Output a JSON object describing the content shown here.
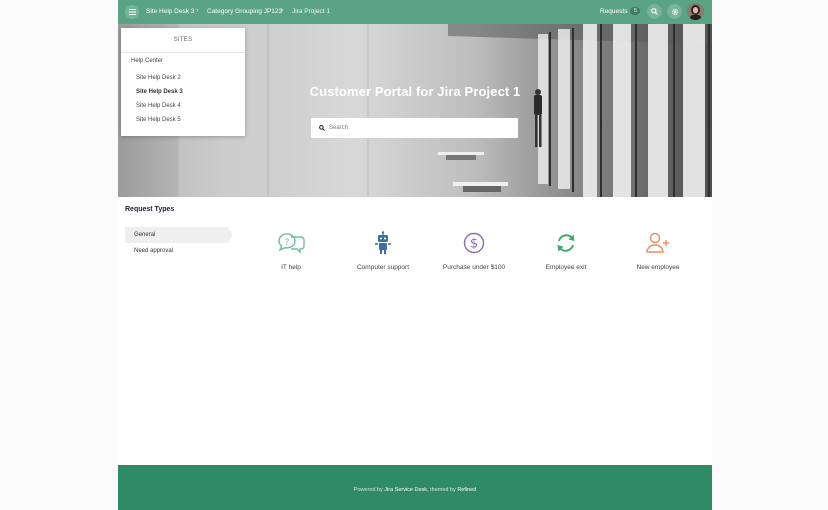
{
  "header": {
    "breadcrumbs": [
      "Site Help Desk 3",
      "Category Grouping JP123",
      "Jira Project 1"
    ],
    "requests_label": "Requests",
    "requests_count": "5"
  },
  "sites_menu": {
    "title": "SITES",
    "group": "Help Center",
    "items": [
      "Site Help Desk 2",
      "Site Help Desk 3",
      "Site Help Desk 4",
      "Site Help Desk 5"
    ],
    "active": "Site Help Desk 3"
  },
  "hero": {
    "title": "Customer Portal for Jira Project 1",
    "search_placeholder": "Search"
  },
  "request_types": {
    "heading": "Request Types",
    "groups": [
      "General",
      "Need approval"
    ],
    "active_group": "General",
    "items": [
      {
        "label": "IT help",
        "icon": "chat-help-icon",
        "color": "#6bbf9c"
      },
      {
        "label": "Computer support",
        "icon": "robot-icon",
        "color": "#3c6fa8"
      },
      {
        "label": "Purchase under $100",
        "icon": "dollar-icon",
        "color": "#8a6fb3"
      },
      {
        "label": "Employee exit",
        "icon": "refresh-icon",
        "color": "#3eaa6a"
      },
      {
        "label": "New employee",
        "icon": "add-user-icon",
        "color": "#f08a5d"
      }
    ]
  },
  "footer": {
    "prefix": "Powered by",
    "product": "Jira Service Desk",
    "middle": ", themed by",
    "theme": "Refined"
  },
  "colors": {
    "topbar": "#5aa384",
    "footer": "#2f8a66"
  }
}
